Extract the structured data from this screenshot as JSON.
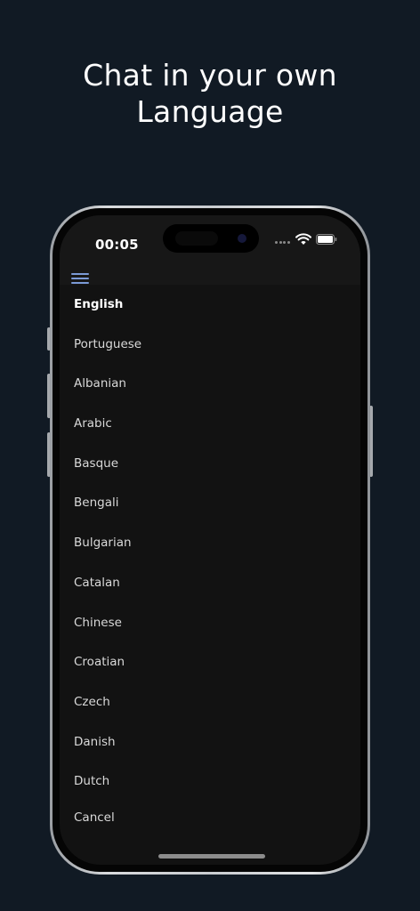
{
  "headline": {
    "line1": "Chat in your own",
    "line2": "Language"
  },
  "status_bar": {
    "time": "00:05"
  },
  "icons": {
    "menu": "hamburger-menu-icon",
    "wifi": "wifi-icon",
    "battery": "battery-icon",
    "signal": "cellular-signal-icon"
  },
  "colors": {
    "page_background": "#111a24",
    "screen_background": "#121212",
    "menu_accent": "#7b9ad6",
    "text": "#d9d9d9"
  },
  "languages": {
    "selected": "English",
    "items": [
      "English",
      "Portuguese",
      "Albanian",
      "Arabic",
      "Basque",
      "Bengali",
      "Bulgarian",
      "Catalan",
      "Chinese",
      "Croatian",
      "Czech",
      "Danish",
      "Dutch"
    ],
    "cancel_label": "Cancel"
  }
}
